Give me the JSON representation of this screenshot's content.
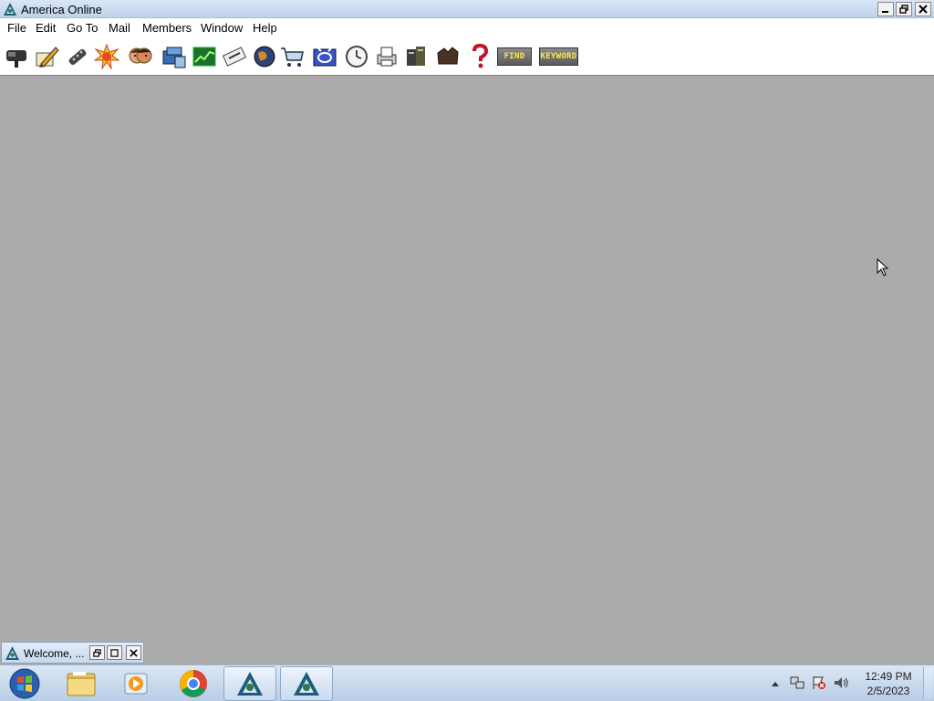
{
  "window": {
    "title": "America  Online",
    "controls": [
      "minimize-button",
      "restore-button",
      "close-button"
    ]
  },
  "menu": [
    "File",
    "Edit",
    "Go To",
    "Mail",
    "Members",
    "Window",
    "Help"
  ],
  "toolbar": {
    "icons": [
      "mailbox-icon",
      "compose-mail-icon",
      "remote-control-icon",
      "hot-news-icon",
      "people-icon",
      "personal-filing-cabinet-icon",
      "stock-chart-icon",
      "news-icon",
      "globe-icon",
      "shopping-cart-icon",
      "channels-icon",
      "clock-icon",
      "print-icon",
      "my-files-icon",
      "favorites-icon",
      "help-question-icon"
    ],
    "find_label": "FIND",
    "keyword_label": "KEYWORD"
  },
  "minimized_window": {
    "title": "Welcome, ..."
  },
  "taskbar": {
    "apps": [
      "start-orb",
      "file-explorer",
      "media-player",
      "chrome",
      "aol-1",
      "aol-2"
    ],
    "clock_time": "12:49 PM",
    "clock_date": "2/5/2023"
  },
  "colors": {
    "workspace": "#ababab",
    "titlebar": "#c8daf0",
    "button_text": "#ffe84a"
  }
}
